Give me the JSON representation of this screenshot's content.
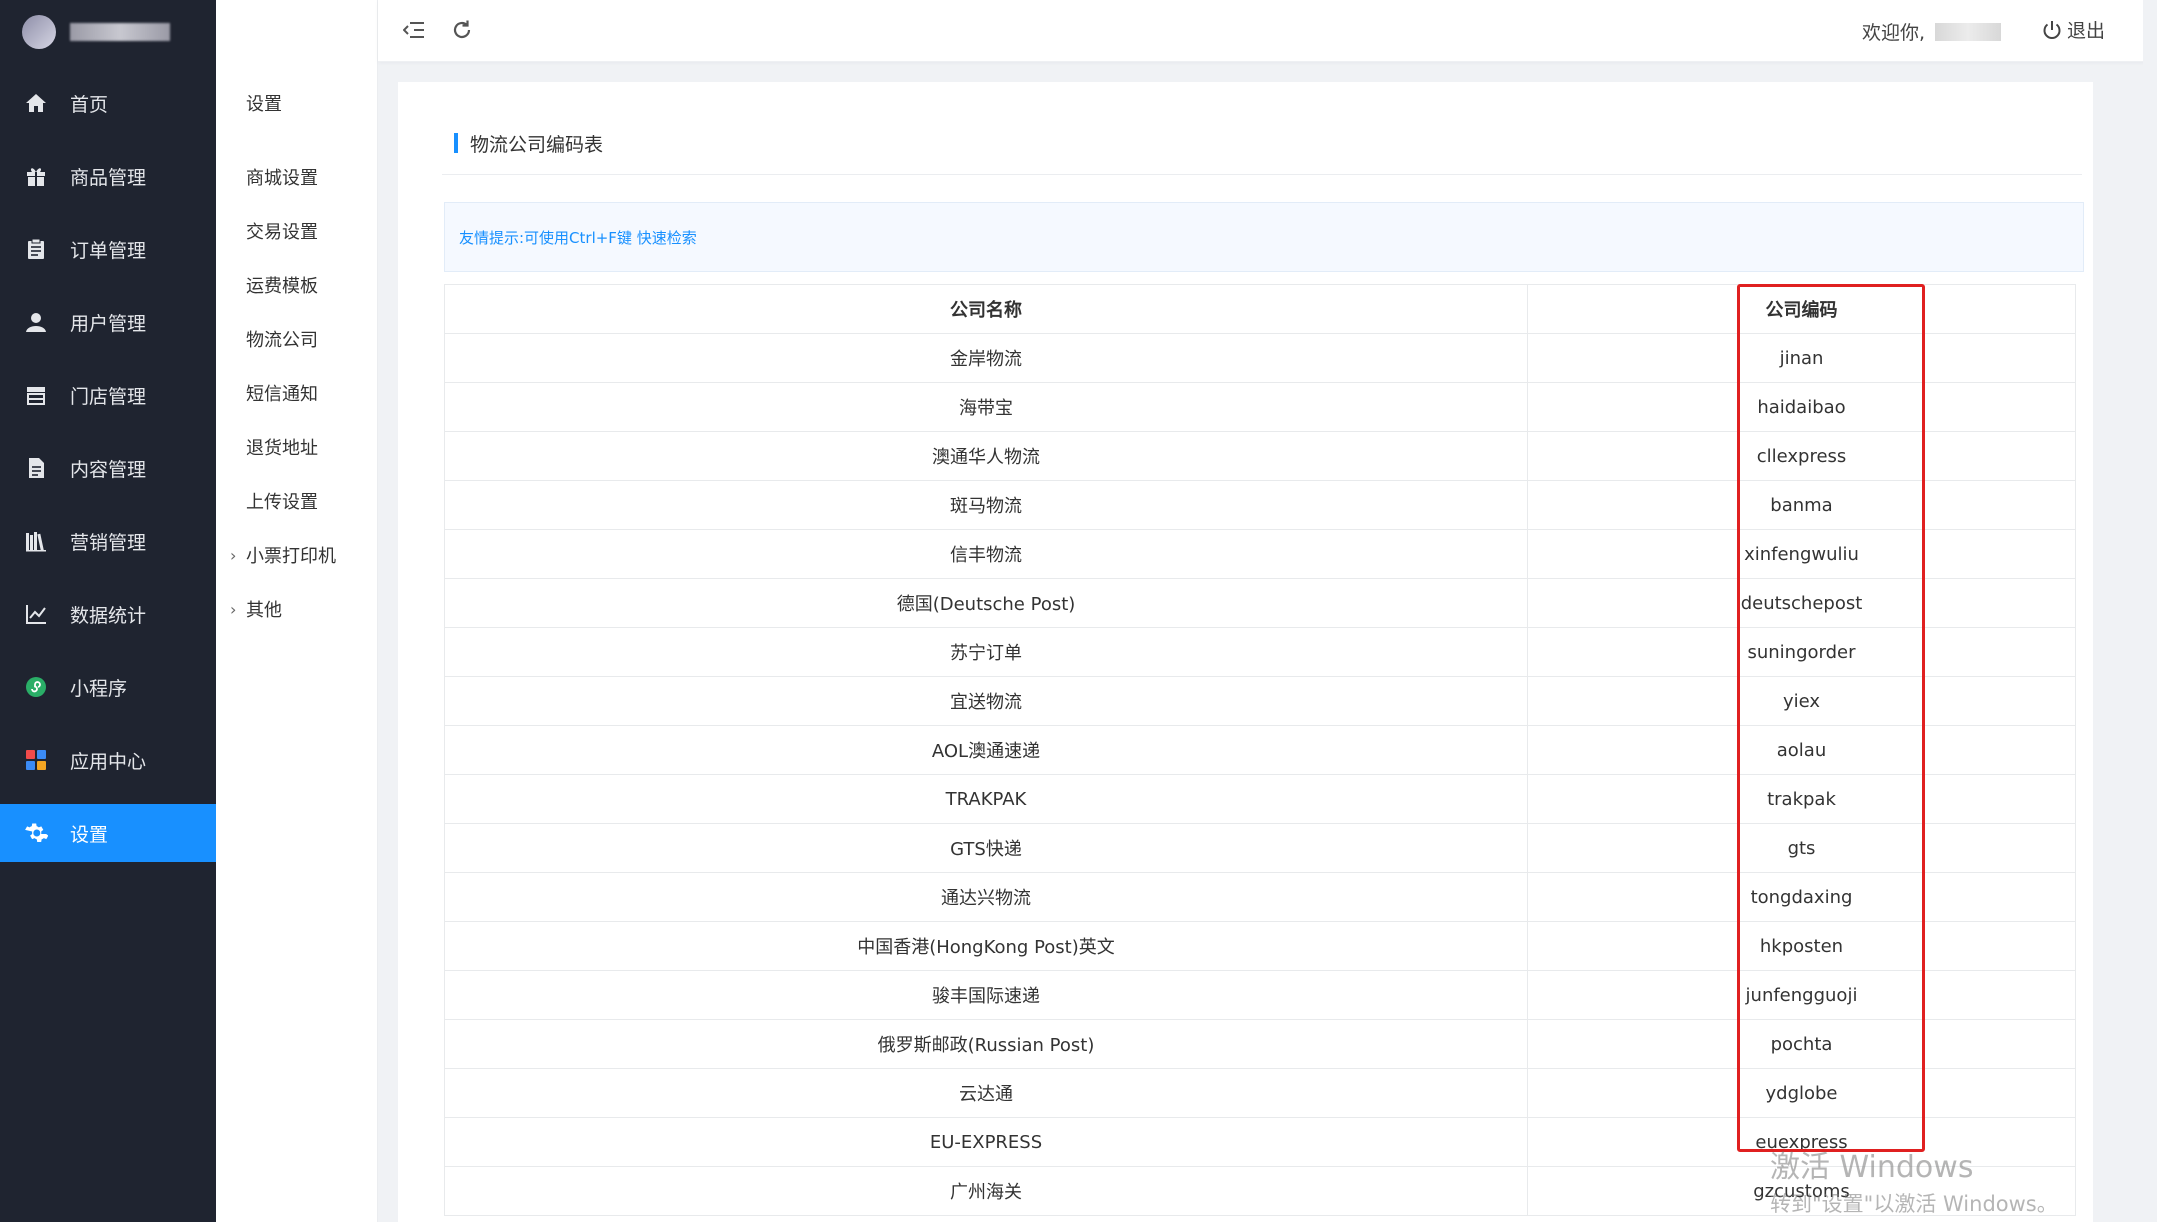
{
  "sidebar": {
    "items": [
      {
        "label": "首页",
        "icon": "home-icon",
        "active": false
      },
      {
        "label": "商品管理",
        "icon": "gift-icon",
        "active": false
      },
      {
        "label": "订单管理",
        "icon": "clipboard-icon",
        "active": false
      },
      {
        "label": "用户管理",
        "icon": "user-icon",
        "active": false
      },
      {
        "label": "门店管理",
        "icon": "store-icon",
        "active": false
      },
      {
        "label": "内容管理",
        "icon": "document-icon",
        "active": false
      },
      {
        "label": "营销管理",
        "icon": "books-icon",
        "active": false
      },
      {
        "label": "数据统计",
        "icon": "line-chart-icon",
        "active": false
      },
      {
        "label": "小程序",
        "icon": "mini-program-icon",
        "active": false
      },
      {
        "label": "应用中心",
        "icon": "apps-icon",
        "active": false
      },
      {
        "label": "设置",
        "icon": "gear-icon",
        "active": true
      }
    ],
    "accent_color": "#1890ff",
    "bg_color": "#1f2430"
  },
  "submenu": {
    "title": "设置",
    "items": [
      {
        "label": "商城设置",
        "expandable": false
      },
      {
        "label": "交易设置",
        "expandable": false
      },
      {
        "label": "运费模板",
        "expandable": false
      },
      {
        "label": "物流公司",
        "expandable": false
      },
      {
        "label": "短信通知",
        "expandable": false
      },
      {
        "label": "退货地址",
        "expandable": false
      },
      {
        "label": "上传设置",
        "expandable": false
      },
      {
        "label": "小票打印机",
        "expandable": true
      },
      {
        "label": "其他",
        "expandable": true
      }
    ]
  },
  "header": {
    "welcome": "欢迎你,",
    "logout": "退出"
  },
  "main": {
    "title": "物流公司编码表",
    "tip": "友情提示:可使用Ctrl+F键 快速检索",
    "table": {
      "headers": [
        "公司名称",
        "公司编码"
      ],
      "rows": [
        [
          "金岸物流",
          "jinan"
        ],
        [
          "海带宝",
          "haidaibao"
        ],
        [
          "澳通华人物流",
          "cllexpress"
        ],
        [
          "斑马物流",
          "banma"
        ],
        [
          "信丰物流",
          "xinfengwuliu"
        ],
        [
          "德国(Deutsche Post)",
          "deutschepost"
        ],
        [
          "苏宁订单",
          "suningorder"
        ],
        [
          "宜送物流",
          "yiex"
        ],
        [
          "AOL澳通速递",
          "aolau"
        ],
        [
          "TRAKPAK",
          "trakpak"
        ],
        [
          "GTS快递",
          "gts"
        ],
        [
          "通达兴物流",
          "tongdaxing"
        ],
        [
          "中国香港(HongKong Post)英文",
          "hkposten"
        ],
        [
          "骏丰国际速递",
          "junfengguoji"
        ],
        [
          "俄罗斯邮政(Russian Post)",
          "pochta"
        ],
        [
          "云达通",
          "ydglobe"
        ],
        [
          "EU-EXPRESS",
          "euexpress"
        ],
        [
          "广州海关",
          "gzcustoms"
        ]
      ]
    },
    "highlight_color": "#e02020"
  },
  "watermark": {
    "line1": "激活 Windows",
    "line2": "转到\"设置\"以激活 Windows。"
  }
}
